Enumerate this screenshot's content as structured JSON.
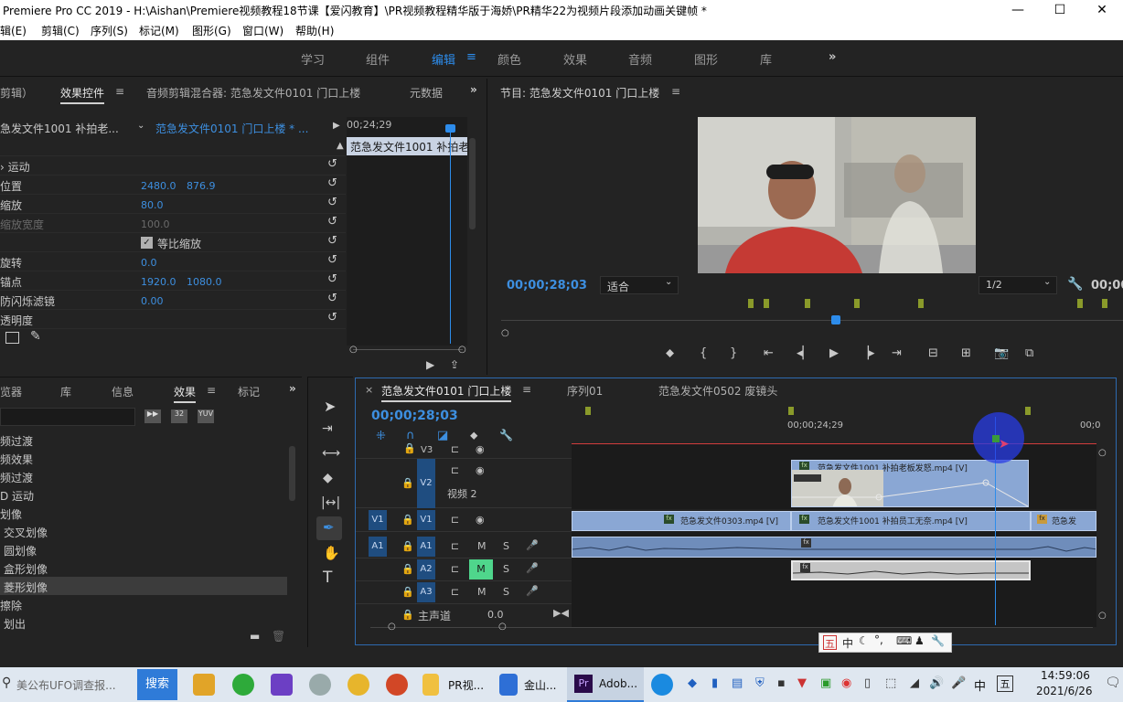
{
  "titlebar": {
    "title": "Premiere Pro CC 2019 - H:\\Aishan\\Premiere视频教程18节课【爱闪教育】\\PR视频教程精华版于海娇\\PR精华22为视频片段添加动画关键帧 *",
    "minimize": "—",
    "maximize": "☐",
    "close": "✕"
  },
  "menu": [
    "辑(E)",
    "剪辑(C)",
    "序列(S)",
    "标记(M)",
    "图形(G)",
    "窗口(W)",
    "帮助(H)"
  ],
  "workspaces": [
    "学习",
    "组件",
    "编辑",
    "颜色",
    "效果",
    "音频",
    "图形",
    "库"
  ],
  "workspaces_more": "»",
  "effect_controls": {
    "tabs": [
      "剪辑）",
      "效果控件",
      "音频剪辑混合器: 范急发文件0101 门口上楼",
      "元数据"
    ],
    "tabs_more": "»",
    "source_clip": "急发文件1001 补拍老...",
    "sequence_clip": "范急发文件0101 门口上楼 * ...",
    "timecode": "00;24;29",
    "clip_bar_label": "范急发文件1001 补拍老",
    "section": "运动",
    "props": [
      {
        "label": "位置",
        "v1": "2480.0",
        "v2": "876.9"
      },
      {
        "label": "缩放",
        "v1": "80.0",
        "v2": ""
      },
      {
        "label": "缩放宽度",
        "v1": "100.0",
        "v2": ""
      },
      {
        "label": "",
        "v1": "",
        "v2": ""
      },
      {
        "label": "旋转",
        "v1": "0.0",
        "v2": ""
      },
      {
        "label": "锚点",
        "v1": "1920.0",
        "v2": "1080.0"
      },
      {
        "label": "防闪烁滤镜",
        "v1": "0.00",
        "v2": ""
      },
      {
        "label": "透明度",
        "v1": "",
        "v2": ""
      }
    ],
    "uniform_scale": "等比缩放"
  },
  "program_monitor": {
    "title": "节目: 范急发文件0101 门口上楼",
    "timecode": "00;00;28;03",
    "fit": "适合",
    "resolution": "1/2",
    "right_timecode": "00;00"
  },
  "effects_panel": {
    "tabs": [
      "览器",
      "库",
      "信息",
      "效果",
      "标记"
    ],
    "tabs_more": "»",
    "items": [
      "频过渡",
      "频效果",
      "频过渡",
      "D 运动",
      "划像",
      "交叉划像",
      "圆划像",
      "盒形划像",
      "菱形划像",
      "擦除",
      "划出"
    ]
  },
  "timeline": {
    "tabs": [
      "范急发文件0101 门口上楼",
      "序列01",
      "范急发文件0502 废镜头"
    ],
    "timecode": "00;00;28;03",
    "ruler_labels": [
      "00;00;24;29",
      "00;0"
    ],
    "tracks": {
      "v3": "V3",
      "v2": "V2",
      "v2_name": "视频 2",
      "v1": "V1",
      "a1": "A1",
      "a2": "A2",
      "a3": "A3",
      "master": "主声道",
      "master_val": "0.0"
    },
    "clips": {
      "v2": "范急发文件1001 补拍老板发怒.mp4 [V]",
      "v1a": "范急发文件0303.mp4 [V]",
      "v1b": "范急发文件1001 补拍员工无奈.mp4 [V]",
      "v1c": "范急发"
    }
  },
  "ime_bar": [
    "五",
    "中"
  ],
  "taskbar": {
    "search_placeholder": "美公布UFO调查报...",
    "search_button": "搜索",
    "apps": [
      "PR视...",
      "金山...",
      "Adob..."
    ],
    "time": "14:59:06",
    "date": "2021/6/26",
    "lang": "中",
    "ime": "五"
  },
  "colors": {
    "accent": "#2d8ceb",
    "clip": "#8aa7d4",
    "selected_track": "#1f4d80",
    "mute_on": "#4fd68c"
  }
}
